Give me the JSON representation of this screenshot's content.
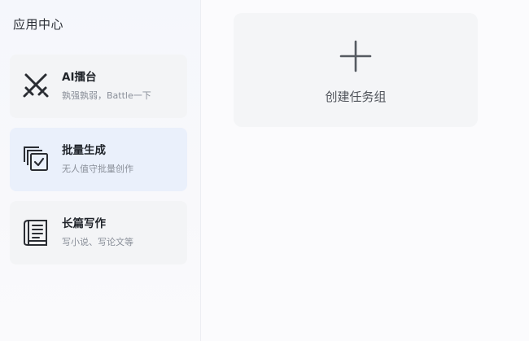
{
  "sidebar": {
    "title": "应用中心",
    "items": [
      {
        "label": "AI擂台",
        "desc": "孰强孰弱，Battle一下",
        "icon": "crossed-swords-icon"
      },
      {
        "label": "批量生成",
        "desc": "无人值守批量创作",
        "icon": "batch-copy-check-icon"
      },
      {
        "label": "长篇写作",
        "desc": "写小说、写论文等",
        "icon": "book-document-icon"
      }
    ]
  },
  "main": {
    "create_group_label": "创建任务组",
    "create_icon": "plus-icon"
  },
  "colors": {
    "active_card": "#eaf0fb",
    "card": "#f3f4f6",
    "background": "#fbfbfd"
  }
}
